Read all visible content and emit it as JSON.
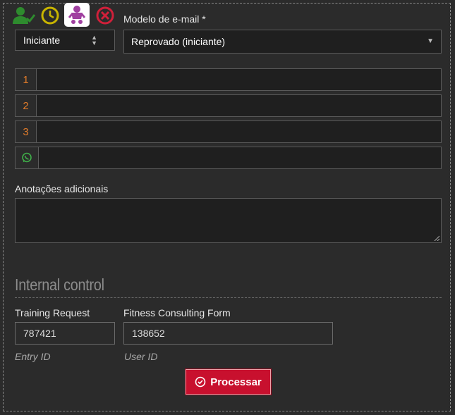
{
  "status_icons": [
    {
      "name": "user-check-icon",
      "color": "#2e8b2e"
    },
    {
      "name": "clock-icon",
      "color": "#c8b400"
    },
    {
      "name": "baby-icon",
      "color": "#a040a0"
    },
    {
      "name": "close-circle-icon",
      "color": "#d0203a"
    }
  ],
  "level_select": {
    "value": "Iniciante"
  },
  "email_template": {
    "label": "Modelo de e-mail *",
    "value": "Reprovado (iniciante)"
  },
  "phones": [
    {
      "addon": "1",
      "value": ""
    },
    {
      "addon": "2",
      "value": ""
    },
    {
      "addon": "3",
      "value": ""
    },
    {
      "addon_icon": "whatsapp-icon",
      "value": ""
    }
  ],
  "notes": {
    "label": "Anotações adicionais",
    "value": ""
  },
  "internal_control": {
    "title": "Internal control",
    "training_request": {
      "label": "Training Request",
      "value": "787421",
      "hint": "Entry ID"
    },
    "fitness_form": {
      "label": "Fitness Consulting Form",
      "value": "138652",
      "hint": "User ID"
    }
  },
  "process_button": {
    "label": "Processar"
  },
  "colors": {
    "accent": "#c8102e",
    "addon_number": "#e07b2a",
    "whatsapp": "#3fae49"
  }
}
